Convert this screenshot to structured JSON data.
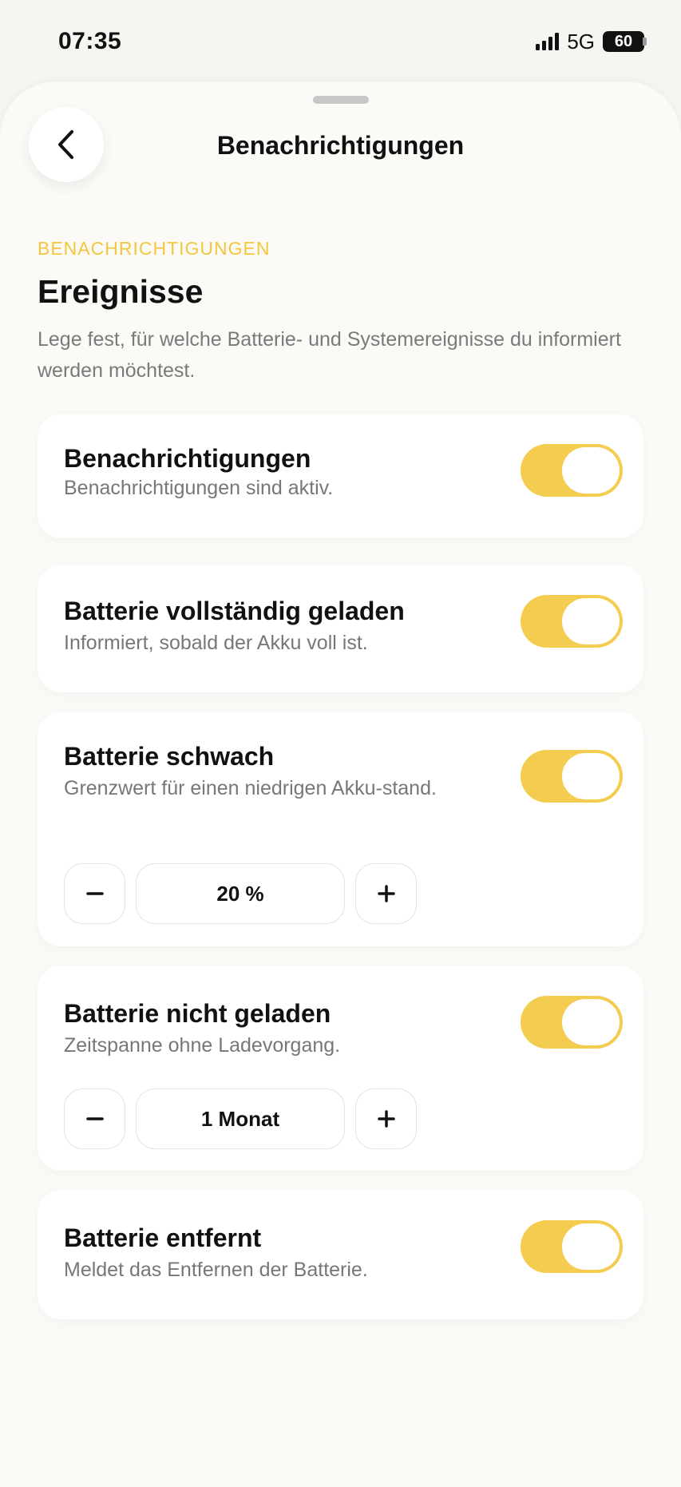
{
  "status_bar": {
    "time": "07:35",
    "network": "5G",
    "battery": "60"
  },
  "nav": {
    "title": "Benachrichtigungen"
  },
  "section": {
    "label": "BENACHRICHTIGUNGEN",
    "title": "Ereignisse",
    "description": "Lege fest, für welche Batterie- und Systemereignisse du informiert werden möchtest."
  },
  "colors": {
    "accent": "#f4cc4f",
    "label": "#f2c73d",
    "background": "#fbfaf7"
  },
  "items": [
    {
      "title": "Benachrichtigungen",
      "description": "Benachrichtigungen sind aktiv.",
      "enabled": true
    },
    {
      "title": "Batterie vollständig geladen",
      "description": "Informiert, sobald der Akku voll ist.",
      "enabled": true
    },
    {
      "title": "Batterie schwach",
      "description": "Grenzwert für einen niedrigen Akku-stand.",
      "enabled": true,
      "stepper_value": "20 %"
    },
    {
      "title": "Batterie nicht geladen",
      "description": "Zeitspanne ohne Ladevorgang.",
      "enabled": true,
      "stepper_value": "1 Monat"
    },
    {
      "title": "Batterie entfernt",
      "description": "Meldet das Entfernen der Batterie.",
      "enabled": true
    }
  ]
}
